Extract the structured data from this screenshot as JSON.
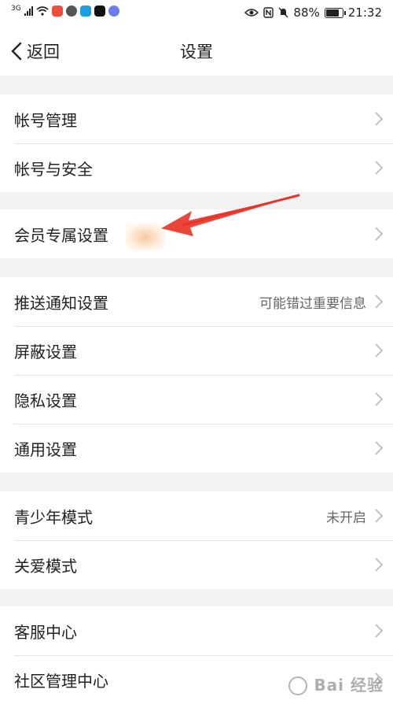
{
  "status_bar": {
    "network": "3G",
    "battery": "88%",
    "time": "21:32"
  },
  "nav": {
    "back_label": "返回",
    "title": "设置"
  },
  "groups": [
    {
      "rows": [
        {
          "label": "帐号管理",
          "value": ""
        },
        {
          "label": "帐号与安全",
          "value": ""
        }
      ]
    },
    {
      "rows": [
        {
          "label": "会员专属设置",
          "value": ""
        }
      ]
    },
    {
      "rows": [
        {
          "label": "推送通知设置",
          "value": "可能错过重要信息"
        },
        {
          "label": "屏蔽设置",
          "value": ""
        },
        {
          "label": "隐私设置",
          "value": ""
        },
        {
          "label": "通用设置",
          "value": ""
        }
      ]
    },
    {
      "rows": [
        {
          "label": "青少年模式",
          "value": "未开启"
        },
        {
          "label": "关爱模式",
          "value": ""
        }
      ]
    },
    {
      "rows": [
        {
          "label": "客服中心",
          "value": ""
        },
        {
          "label": "社区管理中心",
          "value": ""
        }
      ]
    }
  ],
  "annotation": {
    "arrow_color": "#e8352a"
  },
  "watermark": {
    "text": "Bai 经验"
  }
}
